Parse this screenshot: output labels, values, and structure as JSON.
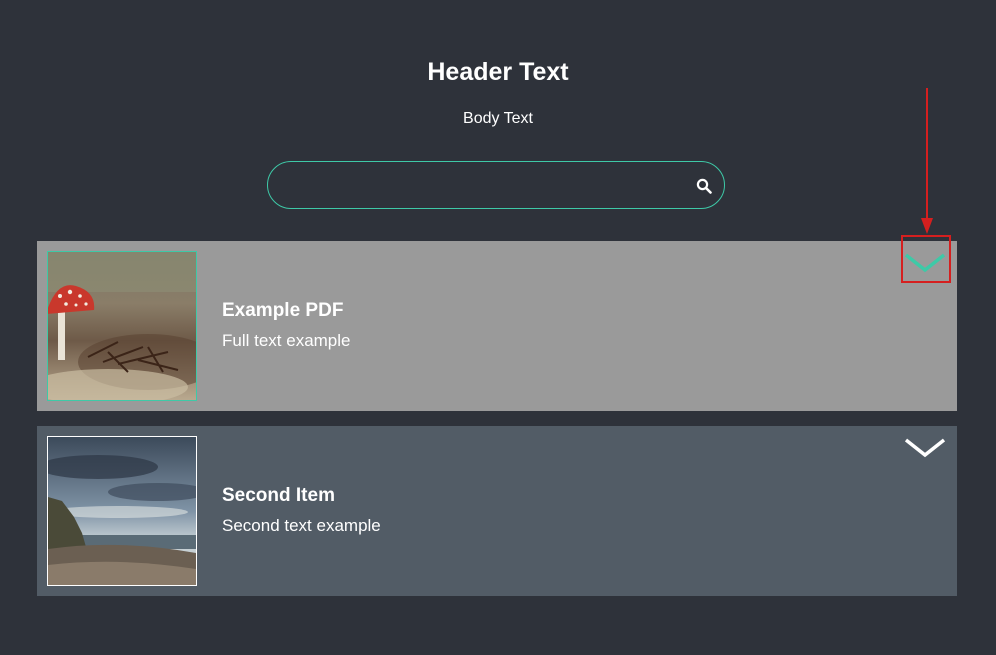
{
  "header": {
    "title": "Header Text",
    "body": "Body Text"
  },
  "search": {
    "value": "",
    "placeholder": "",
    "icon": "search-icon"
  },
  "items": [
    {
      "title": "Example PDF",
      "text": "Full text example",
      "image": "mushroom-photo",
      "background": "#9a9a9a",
      "chevron_color": "#3ec9a7",
      "thumb_border": "#3ec9a7"
    },
    {
      "title": "Second Item",
      "text": "Second text example",
      "image": "coastline-photo",
      "background": "#525c66",
      "chevron_color": "#ffffff",
      "thumb_border": "#ffffff"
    }
  ],
  "annotation": {
    "color": "#d51f1f",
    "target": "first item expand chevron"
  },
  "colors": {
    "page_background": "#2e323a",
    "accent": "#3ec9a7"
  }
}
